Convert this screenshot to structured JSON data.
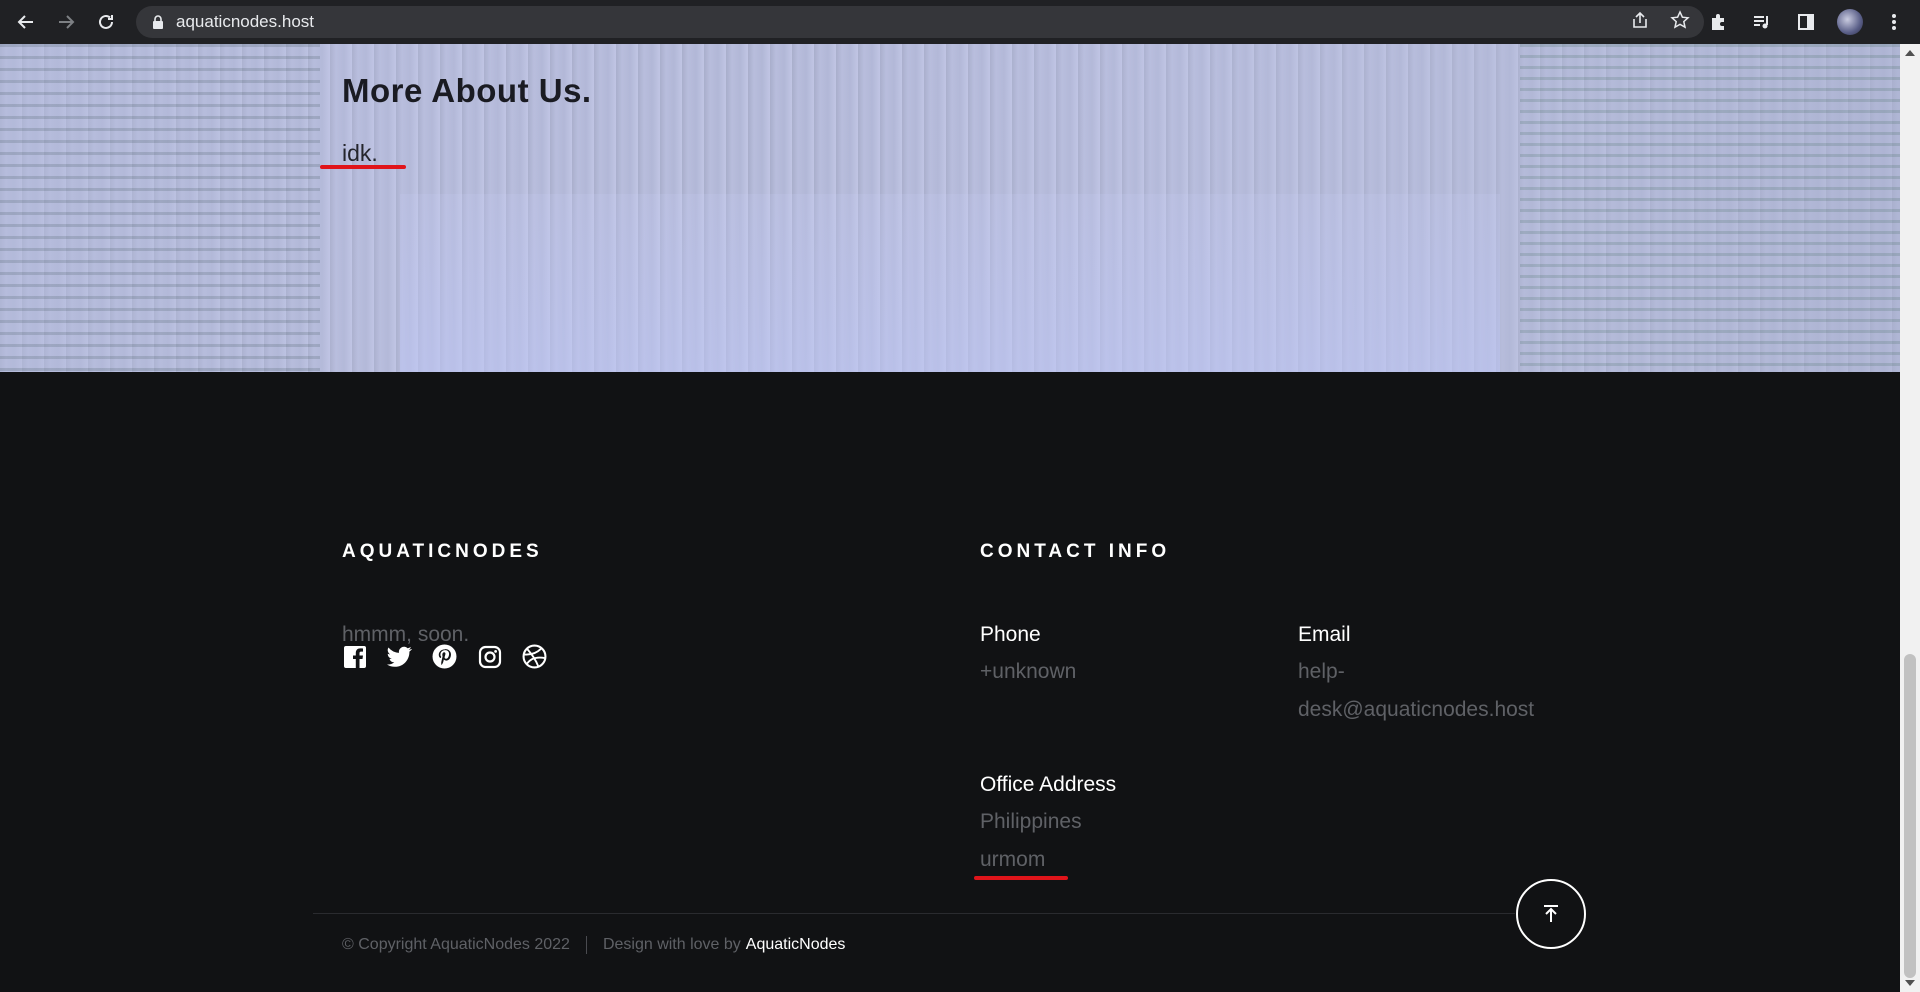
{
  "browser": {
    "url": "aquaticnodes.host"
  },
  "hero": {
    "title": "More About Us.",
    "text": "idk."
  },
  "footer": {
    "brand_heading": "AQUATICNODES",
    "brand_text": "hmmm, soon.",
    "social": [
      "facebook-icon",
      "twitter-icon",
      "pinterest-icon",
      "instagram-icon",
      "dribbble-icon"
    ],
    "contact_heading": "CONTACT INFO",
    "phone_label": "Phone",
    "phone_value": "+unknown",
    "email_label": "Email",
    "email_line1": "help-",
    "email_line2": "desk@aquaticnodes.host",
    "office_label": "Office Address",
    "office_line1": "Philippines",
    "office_line2": "urmom",
    "copyright": "© Copyright AquaticNodes 2022",
    "design_text": "Design with love by",
    "design_brand": "AquaticNodes"
  },
  "colors": {
    "annotation_red": "#e0141a",
    "footer_bg": "#111214",
    "muted_text": "#5f6166"
  }
}
